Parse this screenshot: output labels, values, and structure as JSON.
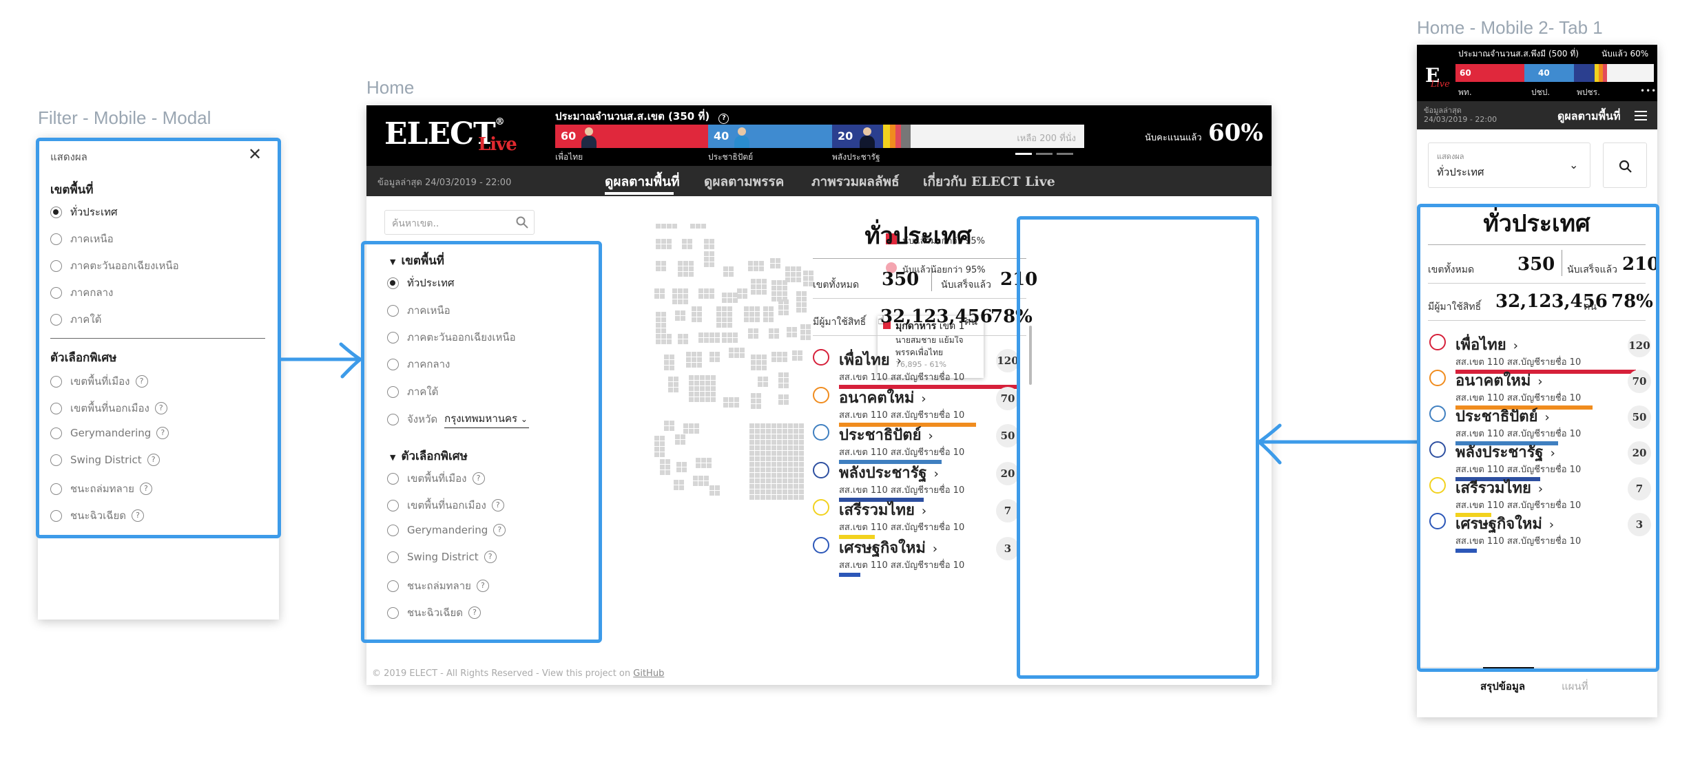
{
  "frames": {
    "filter_label": "Filter - Mobile - Modal",
    "home_label": "Home",
    "mobile_label": "Home - Mobile 2- Tab 1"
  },
  "filter_modal": {
    "title": "แสดงผล",
    "region_heading": "เขตพื้นที่",
    "regions": [
      "ทั่วประเทศ",
      "ภาคเหนือ",
      "ภาคตะวันออกเฉียงเหนือ",
      "ภาคกลาง",
      "ภาคใต้"
    ],
    "special_heading": "ตัวเลือกพิเศษ",
    "specials": [
      "เขตพื้นที่เมือง",
      "เขตพื้นที่นอกเมือง",
      "Gerymandering",
      "Swing District",
      "ชนะถล่มทลาย",
      "ชนะฉิวเฉียด"
    ]
  },
  "home": {
    "seat_title": "ประมาณจำนวนส.ส.เขต (350 ที่)",
    "bar": {
      "pheu_thai": {
        "count": "60",
        "label": "เพื่อไทย",
        "color": "#e0283c"
      },
      "democrat": {
        "count": "40",
        "label": "ประชาธิปัตย์",
        "color": "#3f8bd0"
      },
      "palang": {
        "count": "20",
        "label": "พลังประชารัฐ",
        "color": "#2b3f8f"
      },
      "remaining": "เหลือ 200 ที่นั่ง"
    },
    "counted_label": "นับคะแนนแล้ว",
    "counted_value": "60%",
    "updated": "ข้อมูลล่าสุด  24/03/2019 - 22:00",
    "tabs": [
      "ดูผลตามพื้นที่",
      "ดูผลตามพรรค",
      "ภาพรวมผลลัพธ์",
      "เกี่ยวกับ ELECT Live"
    ],
    "search_placeholder": "ค้นหาเขต..",
    "filter": {
      "region_heading": "เขตพื้นที่",
      "regions": [
        "ทั่วประเทศ",
        "ภาคเหนือ",
        "ภาคตะวันออกเฉียงเหนือ",
        "ภาคกลาง",
        "ภาคใต้"
      ],
      "province_label": "จังหวัด",
      "province_value": "กรุงเทพมหานคร",
      "special_heading": "ตัวเลือกพิเศษ",
      "specials": [
        "เขตพื้นที่เมือง",
        "เขตพื้นที่นอกเมือง",
        "Gerymandering",
        "Swing District",
        "ชนะถล่มทลาย",
        "ชนะฉิวเฉียด"
      ]
    },
    "legend": [
      "นับแล้วมากกว่า 95%",
      "นับแล้วน้อยกว่า 95%"
    ],
    "tooltip": {
      "province": "มุกดาหาร",
      "district": "เขต 1",
      "candidate": "นายสมชาย แย้มใจ",
      "party": "พรรคเพื่อไทย",
      "votes": "76,895 - 61%"
    },
    "footer": "© 2019 ELECT - All Rights Reserved - View this project on",
    "footer_link": "GitHub"
  },
  "summary": {
    "title": "ทั่วประเทศ",
    "total_label": "เขตทั้งหมด",
    "total_value": "350",
    "done_label": "นับเสร็จแล้ว",
    "done_value": "210",
    "voters_label": "มีผู้มาใช้สิทธิ์",
    "voters_value": "32,123,456",
    "voters_unit": "คน",
    "turnout": "78%",
    "sub": "สส.เขต 110  สส.บัญชีรายชื่อ 10",
    "parties": [
      {
        "name": "เพื่อไทย",
        "count": "120",
        "color": "#d6203a",
        "bar": 1.0
      },
      {
        "name": "อนาคตใหม่",
        "count": "70",
        "color": "#f08c1e",
        "bar": 0.76
      },
      {
        "name": "ประชาธิปัตย์",
        "count": "50",
        "color": "#3f7fc0",
        "bar": 0.57
      },
      {
        "name": "พลังประชารัฐ",
        "count": "20",
        "color": "#2d4fa0",
        "bar": 0.47
      },
      {
        "name": "เสรีรวมไทย",
        "count": "7",
        "color": "#f2d21e",
        "bar": 0.2
      },
      {
        "name": "เศรษฐกิจใหม่",
        "count": "3",
        "color": "#2c57b8",
        "bar": 0.12
      }
    ]
  },
  "mobile": {
    "seat_title": "ประมาณจำนวนส.ส.พึงมี (500 ที่)",
    "counted": "นับแล้ว 60%",
    "bar_labels": [
      "พท.",
      "ปชป.",
      "พปชร."
    ],
    "updated_label": "ข้อมูลล่าสุด",
    "updated_value": "24/03/2019 - 22:00",
    "view_label": "ดูผลตามพื้นที่",
    "select_label": "แสดงผล",
    "select_value": "ทั่วประเทศ",
    "tab_summary": "สรุปข้อมูล",
    "tab_map": "แผนที่"
  }
}
